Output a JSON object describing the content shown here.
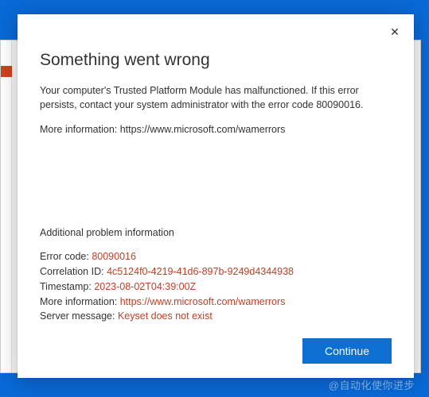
{
  "dialog": {
    "title": "Something went wrong",
    "message_main": "Your computer's Trusted Platform Module has malfunctioned. If this error persists, contact your system administrator with the error code 80090016.",
    "message_more_prefix": "More information: ",
    "message_more_url": "https://www.microsoft.com/wamerrors",
    "additional_heading": "Additional problem information",
    "details": {
      "error_code_label": "Error code: ",
      "error_code_value": "80090016",
      "correlation_label": "Correlation ID: ",
      "correlation_value": "4c5124f0-4219-41d6-897b-9249d4344938",
      "timestamp_label": "Timestamp: ",
      "timestamp_value": "2023-08-02T04:39:00Z",
      "moreinfo_label": "More information: ",
      "moreinfo_value": "https://www.microsoft.com/wamerrors",
      "server_label": "Server message: ",
      "server_value": "Keyset does not exist"
    },
    "continue_label": "Continue",
    "close_glyph": "✕"
  },
  "watermark": "@自动化使你进步"
}
